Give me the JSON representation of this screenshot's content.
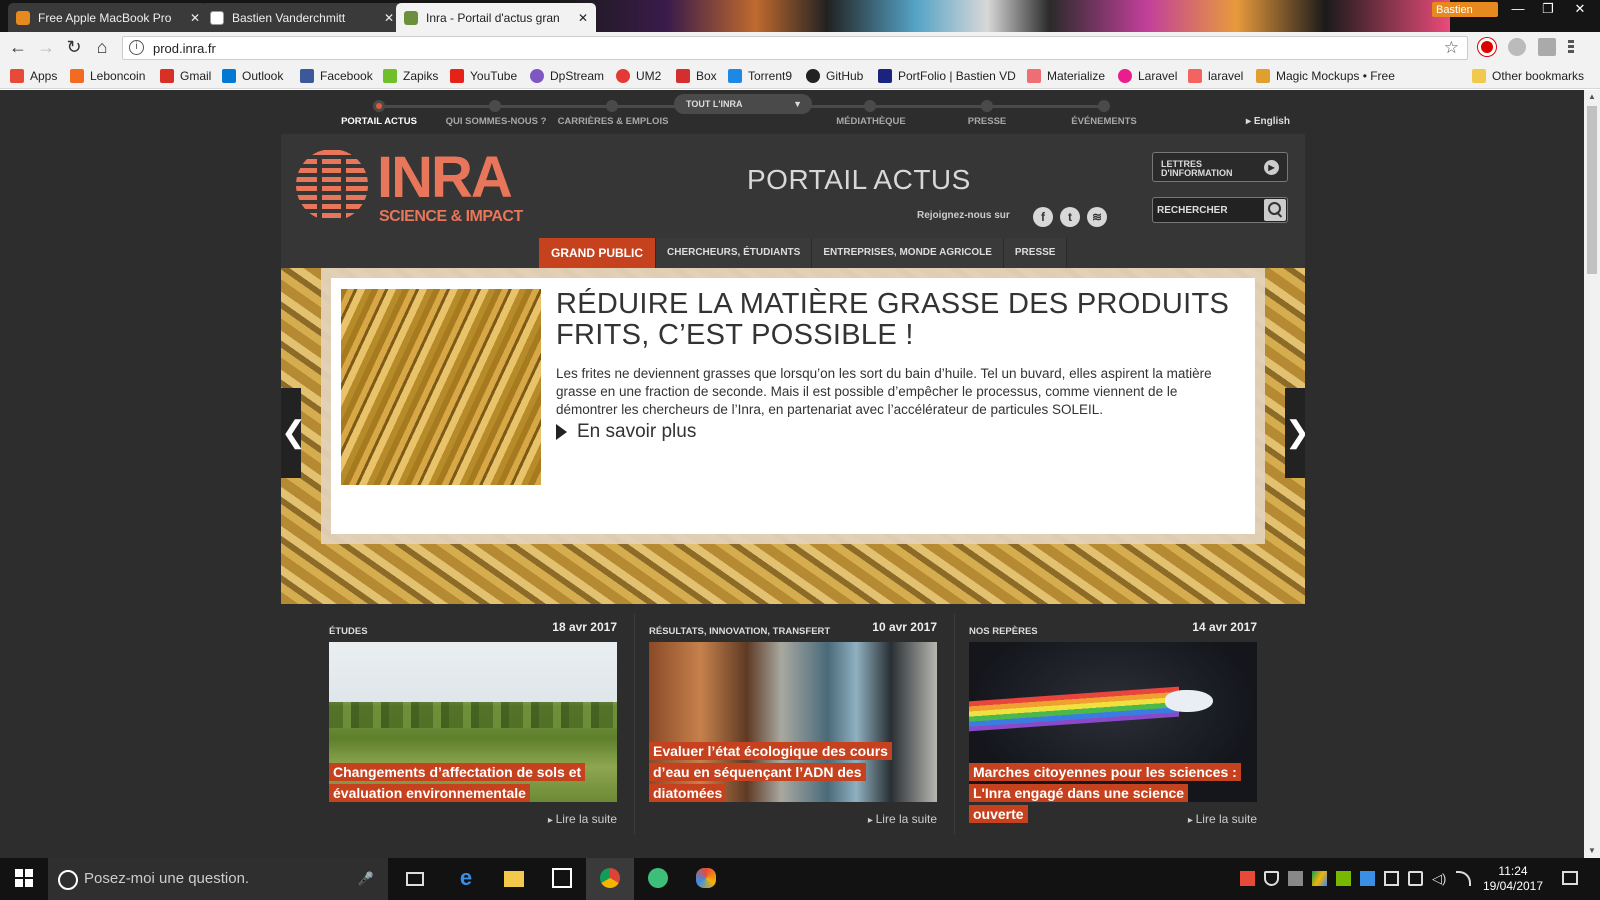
{
  "browser": {
    "tabs": [
      {
        "title": "Free Apple MacBook Pro",
        "favicon_color": "#e68a1f"
      },
      {
        "title": "Bastien Vanderchmitt",
        "favicon_color": "#f2f2f2"
      },
      {
        "title": "Inra - Portail d'actus gran",
        "favicon_color": "#6b8f3a"
      }
    ],
    "profile_name": "Bastien",
    "window_buttons": {
      "minimize": "—",
      "maximize": "❐",
      "close": "✕"
    },
    "nav": {
      "back": "←",
      "forward": "→",
      "reload": "↻",
      "home": "⌂"
    },
    "url": "prod.inra.fr",
    "star": "☆",
    "bookmarks": [
      {
        "label": "Apps",
        "color": "#e84a3a"
      },
      {
        "label": "Leboncoin",
        "color": "#f36b21"
      },
      {
        "label": "Gmail",
        "color": "#d93025"
      },
      {
        "label": "Outlook",
        "color": "#0078d4"
      },
      {
        "label": "Facebook",
        "color": "#3b5998"
      },
      {
        "label": "Zapiks",
        "color": "#6fbf2a"
      },
      {
        "label": "YouTube",
        "color": "#e62117"
      },
      {
        "label": "DpStream",
        "color": "#7e57c2"
      },
      {
        "label": "UM2",
        "color": "#e53935"
      },
      {
        "label": "Box",
        "color": "#d32f2f"
      },
      {
        "label": "Torrent9",
        "color": "#1e88e5"
      },
      {
        "label": "GitHub",
        "color": "#222222"
      },
      {
        "label": "PortFolio | Bastien VD",
        "color": "#1a237e"
      },
      {
        "label": "Materialize",
        "color": "#ee6e73"
      },
      {
        "label": "Laravel",
        "color": "#e91e8c"
      },
      {
        "label": "laravel",
        "color": "#f4645f"
      },
      {
        "label": "Magic Mockups • Free",
        "color": "#e0a030"
      }
    ],
    "other_bookmarks": "Other bookmarks"
  },
  "site": {
    "topnav": {
      "items": [
        "PORTAIL ACTUS",
        "QUI SOMMES-NOUS ?",
        "CARRIÈRES & EMPLOIS",
        "MÉDIATHÈQUE",
        "PRESSE",
        "ÉVÉNEMENTS"
      ],
      "dropdown": "TOUT L'INRA",
      "dropdown_caret": "▼",
      "language": "English"
    },
    "header": {
      "logo_brand": "INRA",
      "logo_tagline": "SCIENCE & IMPACT",
      "title": "PORTAIL ACTUS",
      "join_us": "Rejoignez-nous sur",
      "social": [
        "f",
        "t",
        "≋"
      ],
      "newsletter": [
        "LETTRES",
        "D'INFORMATION"
      ],
      "newsletter_go": "▶",
      "search_placeholder": "RECHERCHER"
    },
    "audience_tabs": [
      "GRAND PUBLIC",
      "CHERCHEURS, ÉTUDIANTS",
      "ENTREPRISES, MONDE AGRICOLE",
      "PRESSE"
    ],
    "hero": {
      "title": "RÉDUIRE LA MATIÈRE GRASSE DES PRODUITS FRITS, C’EST POSSIBLE !",
      "text": "Les frites ne deviennent grasses que lorsqu’on les sort du bain d’huile. Tel un buvard, elles aspirent la matière grasse en une fraction de seconde. Mais il est possible d’empêcher le processus, comme viennent de le démontrer les chercheurs de l’Inra, en partenariat avec l’accélérateur de particules SOLEIL.",
      "more": "En savoir plus",
      "prev": "❮",
      "next": "❯"
    },
    "news": [
      {
        "category": "ÉTUDES",
        "date": "18 avr 2017",
        "caption": "Changements d’affectation de sols et évaluation environnementale",
        "more": "Lire la suite"
      },
      {
        "category": "RÉSULTATS, INNOVATION, TRANSFERT",
        "date": "10 avr 2017",
        "caption": "Evaluer l’état écologique des cours d’eau en séquençant l’ADN des diatomées",
        "more": "Lire la suite"
      },
      {
        "category": "NOS REPÈRES",
        "date": "14 avr 2017",
        "caption": "Marches citoyennes pour les sciences : L'Inra engagé dans une science ouverte",
        "more": "Lire la suite"
      }
    ]
  },
  "taskbar": {
    "search_placeholder": "Posez-moi une question.",
    "mic": "🎤",
    "time": "11:24",
    "date": "19/04/2017"
  },
  "colors": {
    "accent": "#c6421f",
    "brand": "#e8765a"
  }
}
